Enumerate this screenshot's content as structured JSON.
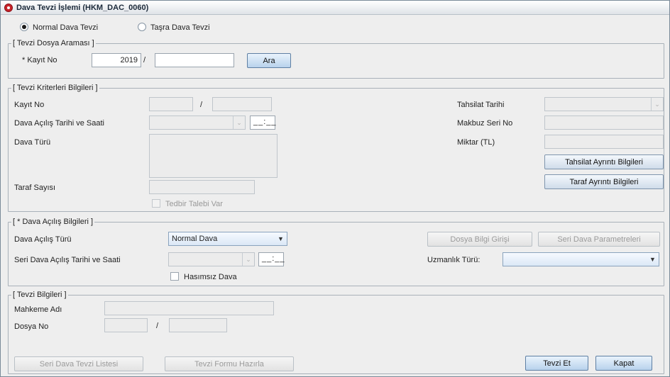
{
  "window": {
    "title": "Dava Tevzi İşlemi (HKM_DAC_0060)"
  },
  "radios": {
    "normal": "Normal Dava Tevzi",
    "tasra": "Taşra Dava Tevzi"
  },
  "search": {
    "legend": "[ Tevzi Dosya Araması ]",
    "kayit_label": "* Kayıt No",
    "year_value": "2019",
    "slash": "/",
    "number_value": "",
    "ara_button": "Ara"
  },
  "criteria": {
    "legend": "[ Tevzi Kriterleri Bilgileri ]",
    "kayit_label": "Kayıt No",
    "slash": "/",
    "acilis_label": "Dava Açılış Tarihi ve Saati",
    "time_placeholder": "__:__",
    "dava_turu_label": "Dava Türü",
    "taraf_sayisi_label": "Taraf Sayısı",
    "tedbir_label": "Tedbir Talebi Var",
    "tahsilat_tarihi_label": "Tahsilat Tarihi",
    "makbuz_label": "Makbuz Seri No",
    "miktar_label": "Miktar (TL)",
    "tahsilat_button": "Tahsilat Ayrıntı Bilgileri",
    "taraf_button": "Taraf Ayrıntı Bilgileri"
  },
  "acilis": {
    "legend": "[ * Dava Açılış Bilgileri ]",
    "turu_label": "Dava Açılış Türü",
    "turu_value": "Normal Dava",
    "seri_label": "Seri Dava Açılış Tarihi ve Saati",
    "time_placeholder": "__:__",
    "hasimsiz_label": "Hasımsız Dava",
    "dosya_bilgi_button": "Dosya Bilgi Girişi",
    "seri_param_button": "Seri Dava Parametreleri",
    "uzmanlik_label": "Uzmanlık Türü:"
  },
  "tevzi": {
    "legend": "[ Tevzi Bilgileri ]",
    "mahkeme_label": "Mahkeme Adı",
    "dosya_label": "Dosya No",
    "slash": "/"
  },
  "footer": {
    "seri_listesi_button": "Seri Dava Tevzi Listesi",
    "form_button": "Tevzi Formu Hazırla",
    "tevzi_et_button": "Tevzi Et",
    "kapat_button": "Kapat"
  },
  "icons": {
    "title": "app-logo-icon",
    "dropdown": "chevron-down-icon"
  }
}
